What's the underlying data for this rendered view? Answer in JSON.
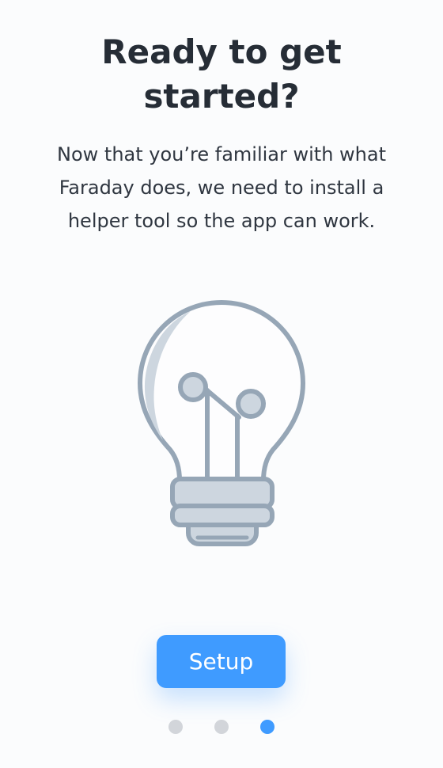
{
  "onboarding": {
    "title": "Ready to get started?",
    "description": "Now that you’re familiar with what Faraday does, we need to install a helper tool so the app can work.",
    "illustration_icon": "lightbulb-icon",
    "setup_button_label": "Setup",
    "pager": {
      "total_pages": 3,
      "current_page": 3
    }
  },
  "colors": {
    "accent": "#3f9bff",
    "illustration_stroke": "#96a6b6",
    "illustration_fill": "#cdd6df",
    "dot_inactive": "#d2d5da"
  }
}
